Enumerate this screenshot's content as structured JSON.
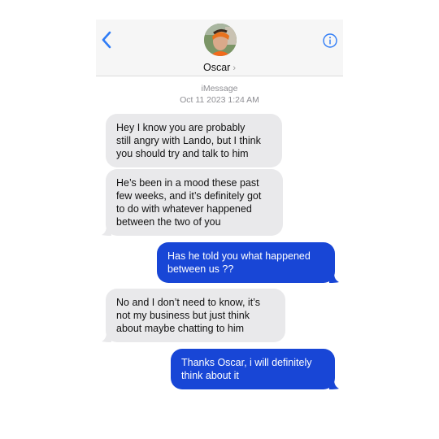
{
  "header": {
    "contact_name": "Oscar",
    "name_chevron": "›",
    "back_icon": "chevron-left-icon",
    "info_icon": "info-icon",
    "accent_color": "#2f7cf6"
  },
  "conversation": {
    "service": "iMessage",
    "timestamp": "Oct 11 2023 1:24 AM"
  },
  "messages": [
    {
      "direction": "incoming",
      "text": "Hey I know you are probably\nstill angry with Lando, but I think\nyou should try and talk to him"
    },
    {
      "direction": "incoming",
      "text": "He’s been in a mood these past\nfew weeks, and it’s definitely got\nto do with whatever happened\nbetween the two of you"
    },
    {
      "direction": "outgoing",
      "text": "Has he told you what happened\nbetween us ??"
    },
    {
      "direction": "incoming",
      "text": "No and I don’t need to know, it’s\nnot my business but just think\nabout maybe chatting to him"
    },
    {
      "direction": "outgoing",
      "text": "Thanks Oscar, i will definitely\nthink about it"
    }
  ],
  "colors": {
    "incoming_bubble": "#e9e9eb",
    "outgoing_bubble": "#1846d6",
    "header_bg": "#f6f6f6"
  }
}
